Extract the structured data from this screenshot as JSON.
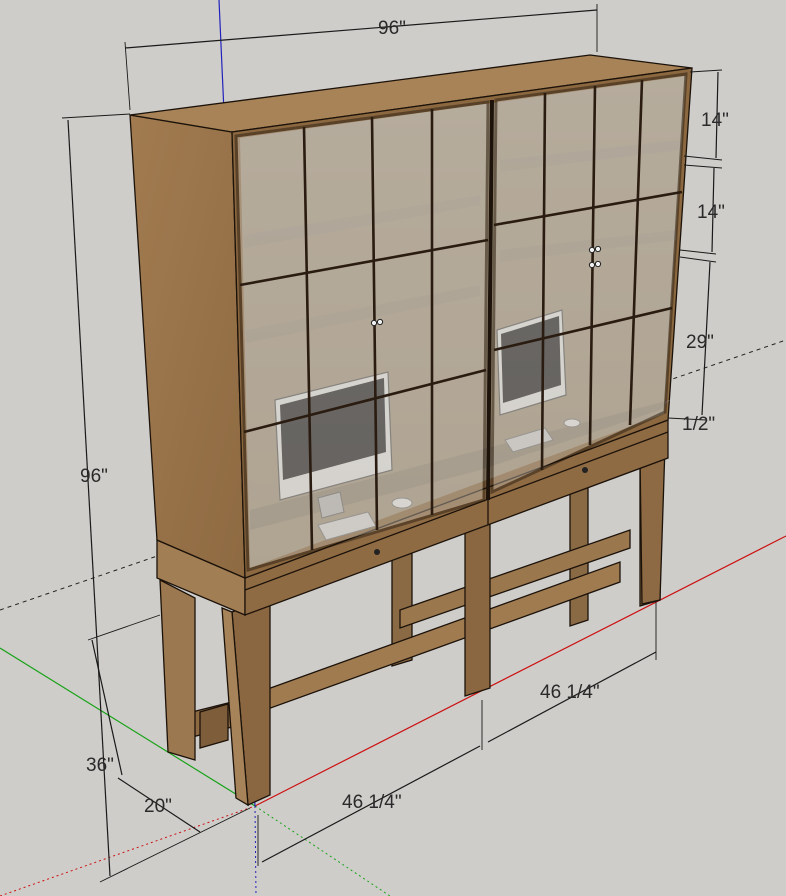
{
  "dimensions": {
    "overall_width": "96\"",
    "overall_height": "96\"",
    "upper_pane_height": "14\"",
    "middle_pane_height": "14\"",
    "lower_pane_height": "29\"",
    "gap": "1/2\"",
    "base_height": "36\"",
    "depth": "20\"",
    "left_section_width": "46 1/4\"",
    "right_section_width": "46 1/4\""
  },
  "colors": {
    "background": "#cfcdca",
    "wood_front": "#8b6840",
    "wood_side": "#a07a4f",
    "wood_top": "#a88357",
    "glass": "#c8c4bc",
    "frame": "#2a1c10",
    "axis_red": "#cc1111",
    "axis_green": "#11aa11",
    "axis_blue": "#2222bb"
  }
}
